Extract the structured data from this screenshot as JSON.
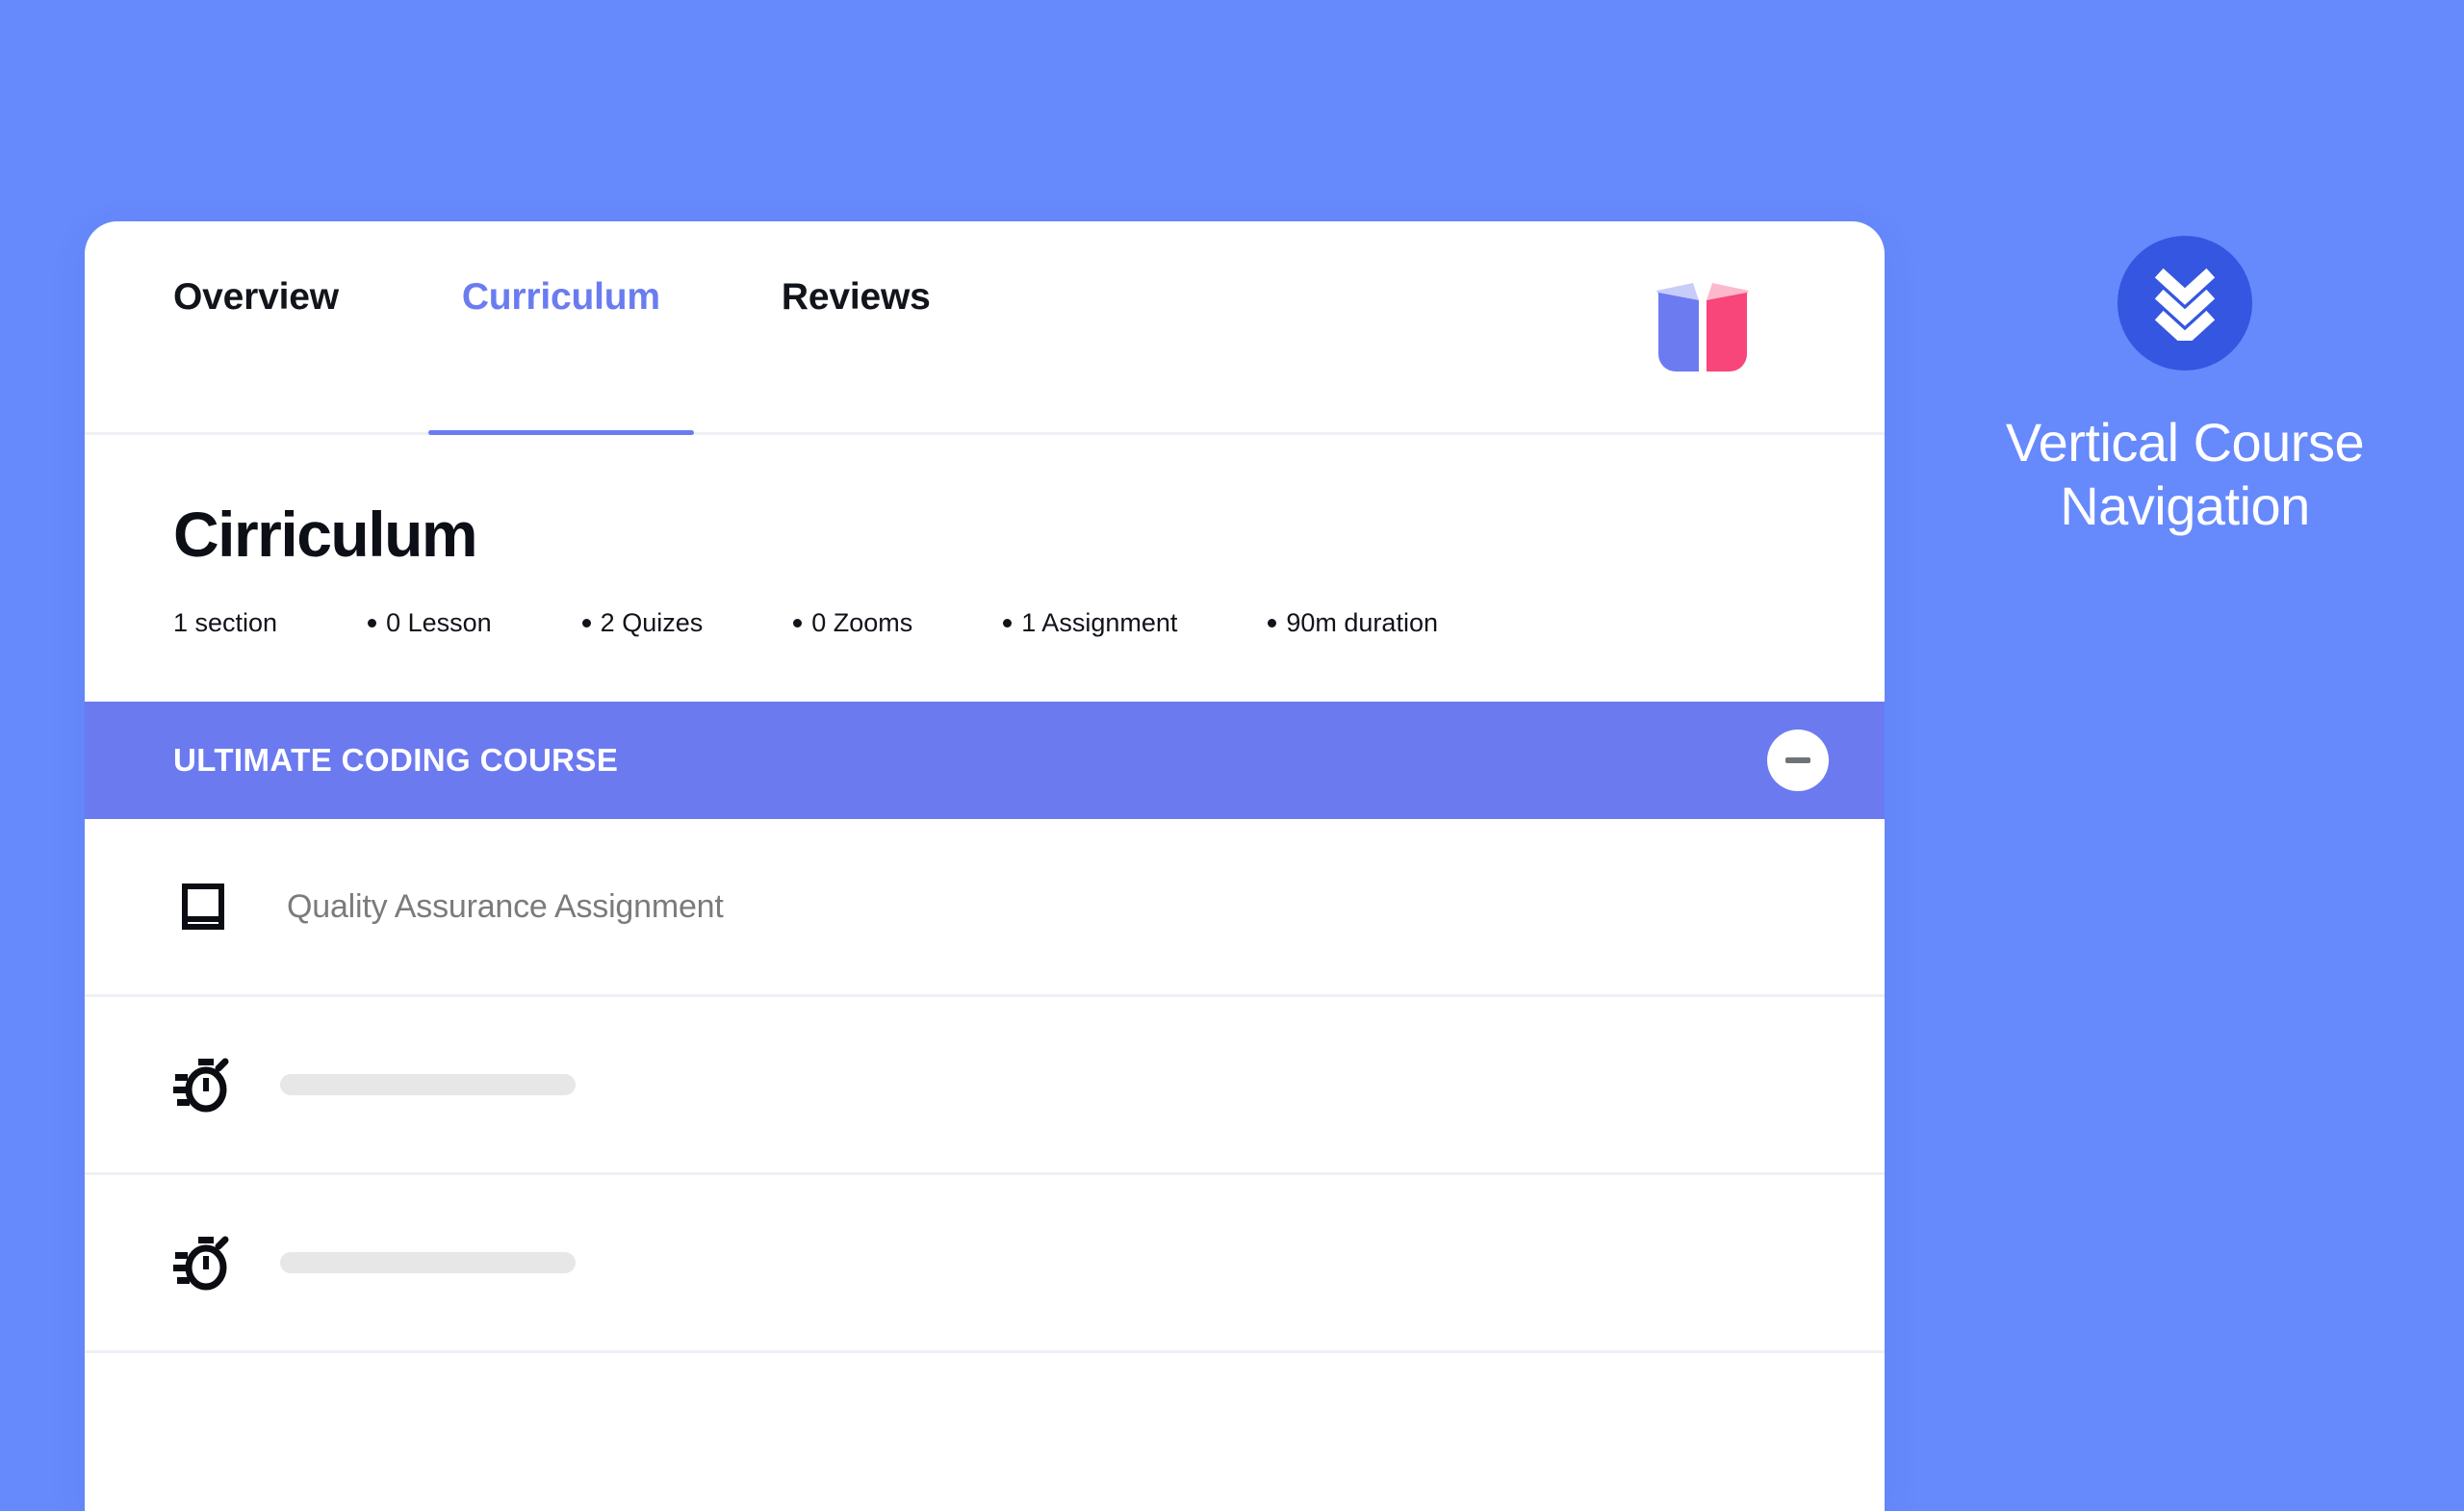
{
  "theme": {
    "page_background": "#6689FC",
    "accent_blue": "#6A7CF0",
    "section_band": "#6C7AF0",
    "badge_blue": "#3556E0",
    "logo_left_page": "#6C7BF0",
    "logo_right_page": "#F8467A",
    "muted_text": "#7B7B7B",
    "divider": "#EEF0F6",
    "skeleton": "#E7E7E7"
  },
  "tabs": [
    {
      "label": "Overview",
      "active": false
    },
    {
      "label": "Curriculum",
      "active": true
    },
    {
      "label": "Reviews",
      "active": false
    }
  ],
  "logo": {
    "icon": "open-book-icon"
  },
  "page": {
    "title": "Cirriculum",
    "meta": [
      {
        "label": "1 section",
        "bullet": false
      },
      {
        "label": "0 Lesson",
        "bullet": true
      },
      {
        "label": "2 Quizes",
        "bullet": true
      },
      {
        "label": "0 Zooms",
        "bullet": true
      },
      {
        "label": "1 Assignment",
        "bullet": true
      },
      {
        "label": "90m duration",
        "bullet": true
      }
    ]
  },
  "section": {
    "title": "ULTIMATE CODING COURSE",
    "collapse_icon": "minus-icon",
    "expanded": true
  },
  "lessons": [
    {
      "icon": "book-icon",
      "label": "Quality Assurance Assignment",
      "placeholder": false
    },
    {
      "icon": "stopwatch-icon",
      "label": "",
      "placeholder": true
    },
    {
      "icon": "stopwatch-icon",
      "label": "",
      "placeholder": true
    }
  ],
  "annotation": {
    "icon": "double-chevron-down-icon",
    "text": "Vertical Course Navigation"
  }
}
